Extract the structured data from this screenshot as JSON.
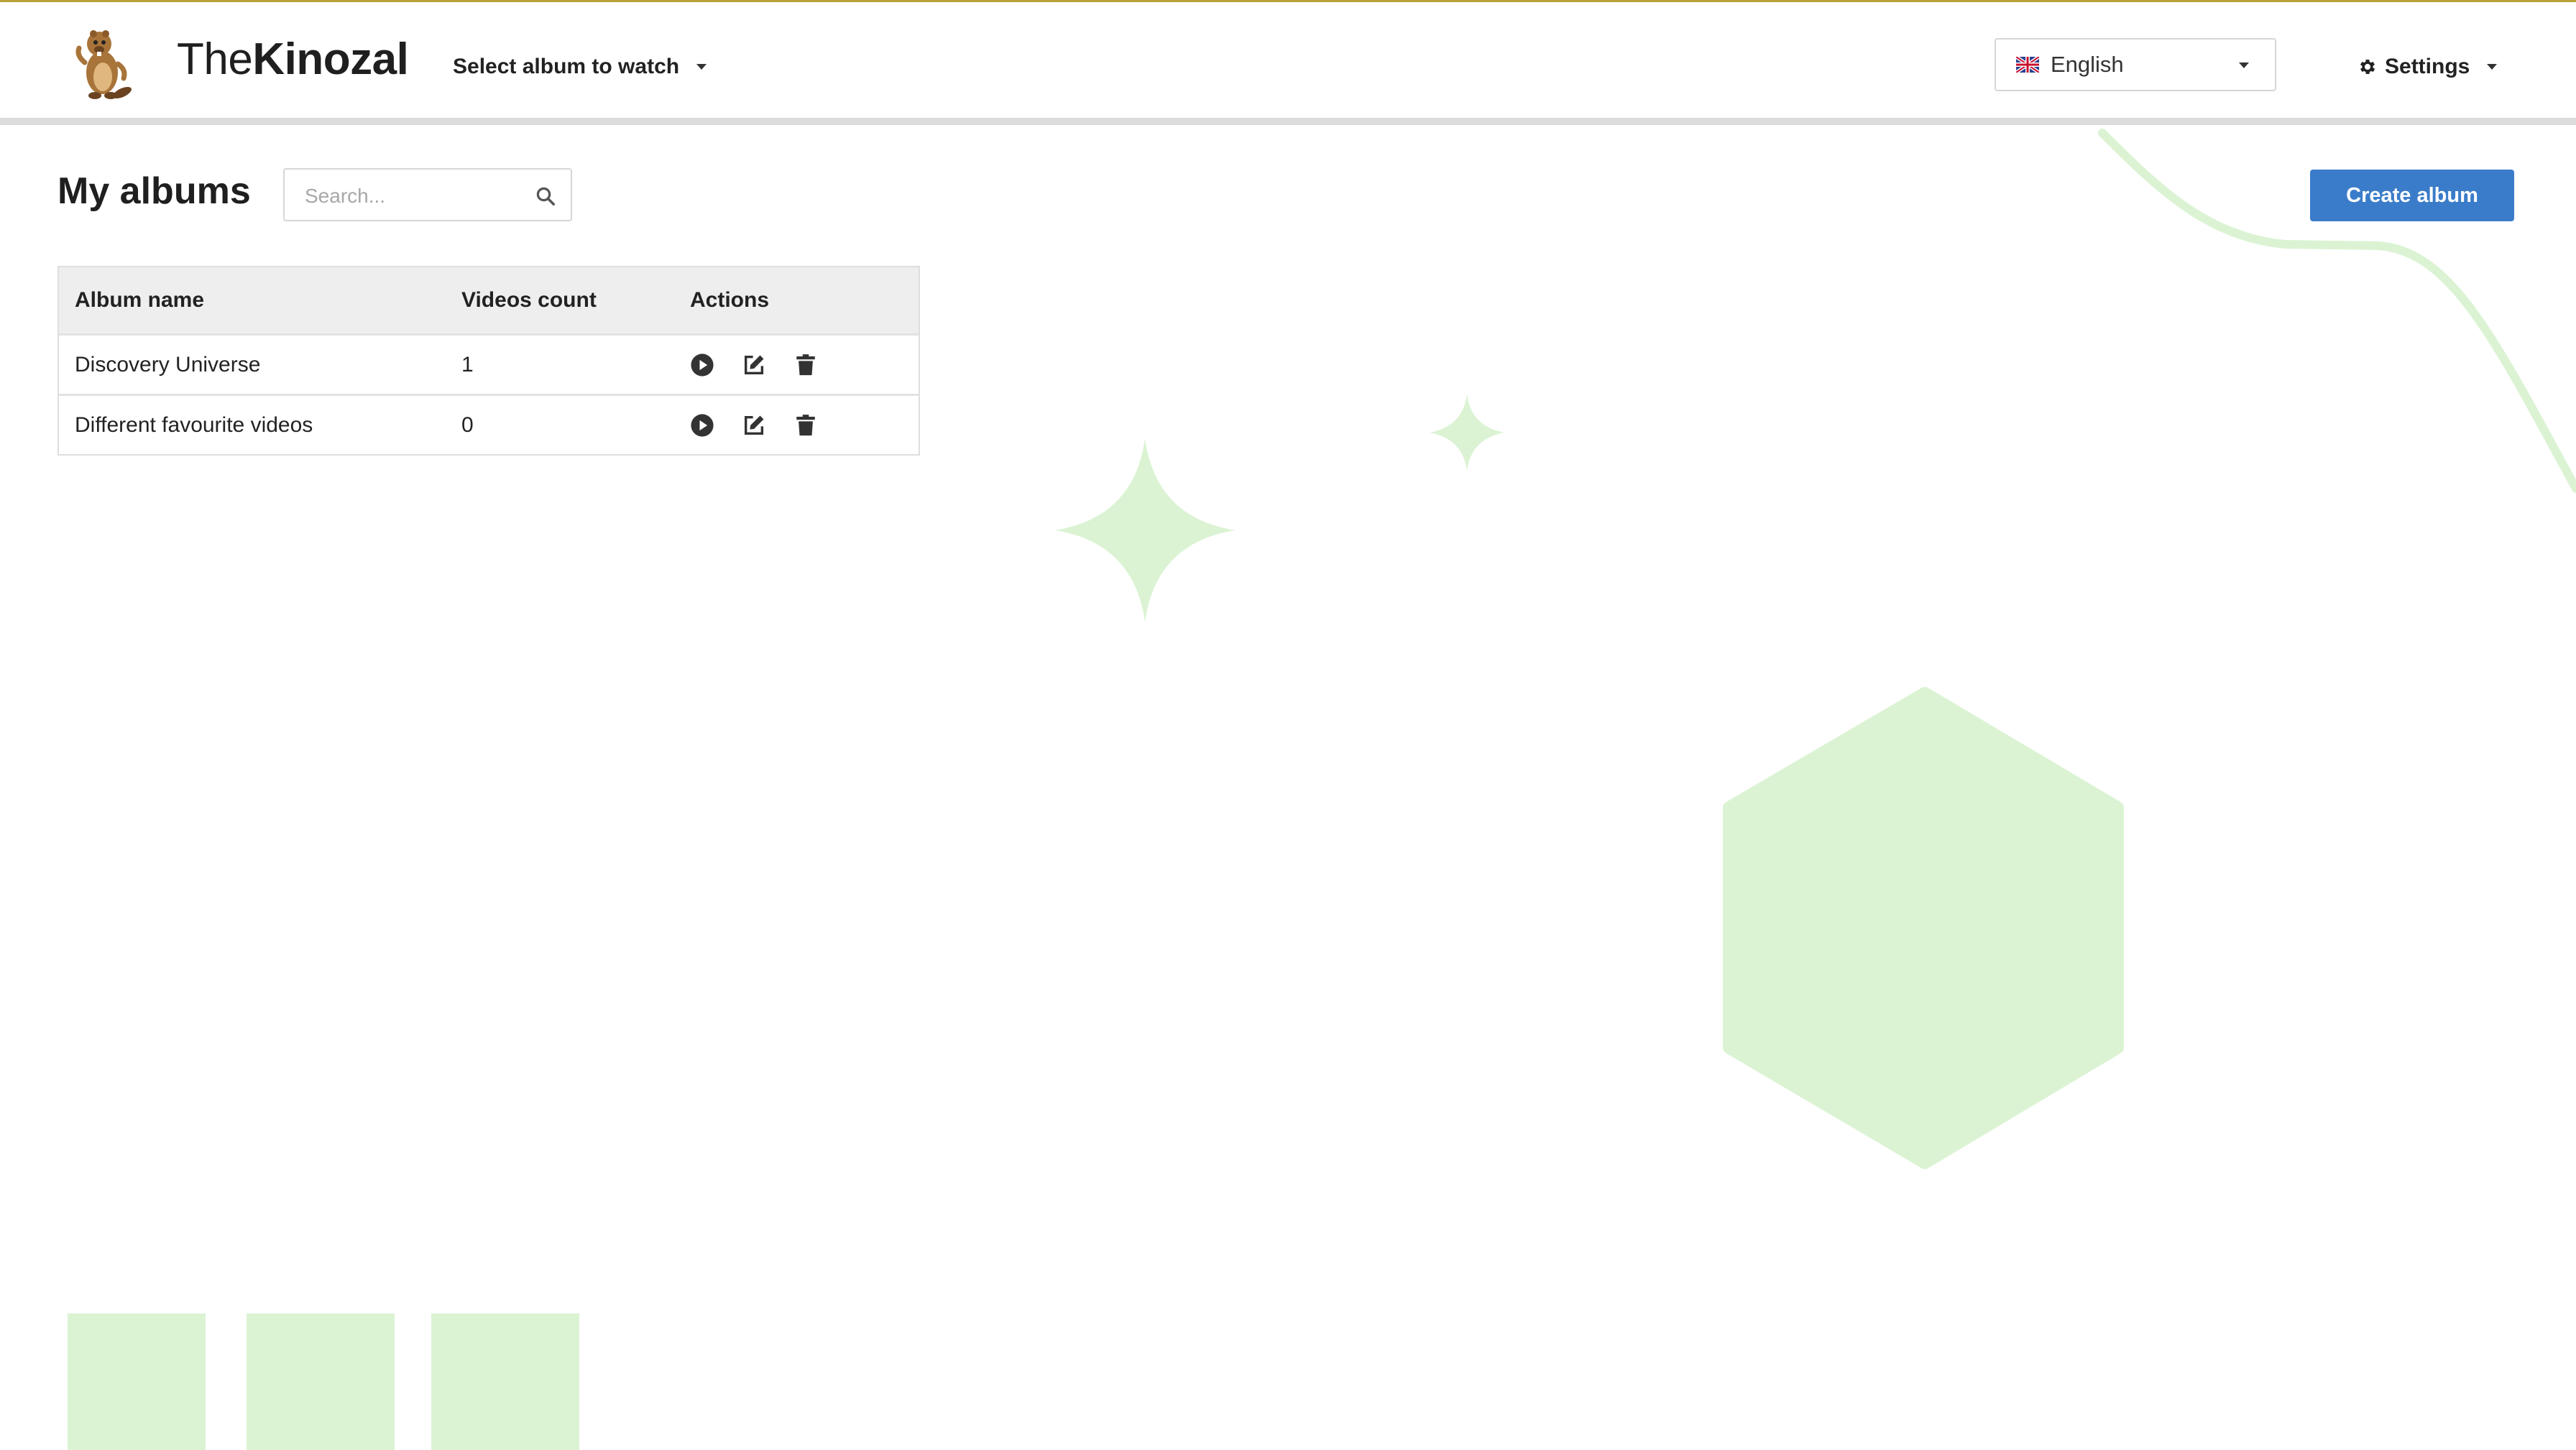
{
  "header": {
    "brand_prefix": "The",
    "brand_main": "Kinozal",
    "album_select_label": "Select album to watch",
    "language": {
      "selected": "English",
      "flag_icon": "uk-flag-icon"
    },
    "settings_label": "Settings",
    "settings_icon": "gear-icon"
  },
  "main": {
    "title": "My albums",
    "search": {
      "placeholder": "Search...",
      "value": "",
      "icon": "search-icon"
    },
    "create_button_label": "Create album",
    "table": {
      "columns": [
        "Album name",
        "Videos count",
        "Actions"
      ],
      "rows": [
        {
          "name": "Discovery Universe",
          "count": "1"
        },
        {
          "name": "Different favourite videos",
          "count": "0"
        }
      ],
      "action_icons": [
        "play-icon",
        "edit-icon",
        "trash-icon"
      ]
    }
  },
  "colors": {
    "primary_button": "#3a7cc9",
    "decor_green": "#dbf3d3",
    "header_top_border": "#b8a23a"
  }
}
